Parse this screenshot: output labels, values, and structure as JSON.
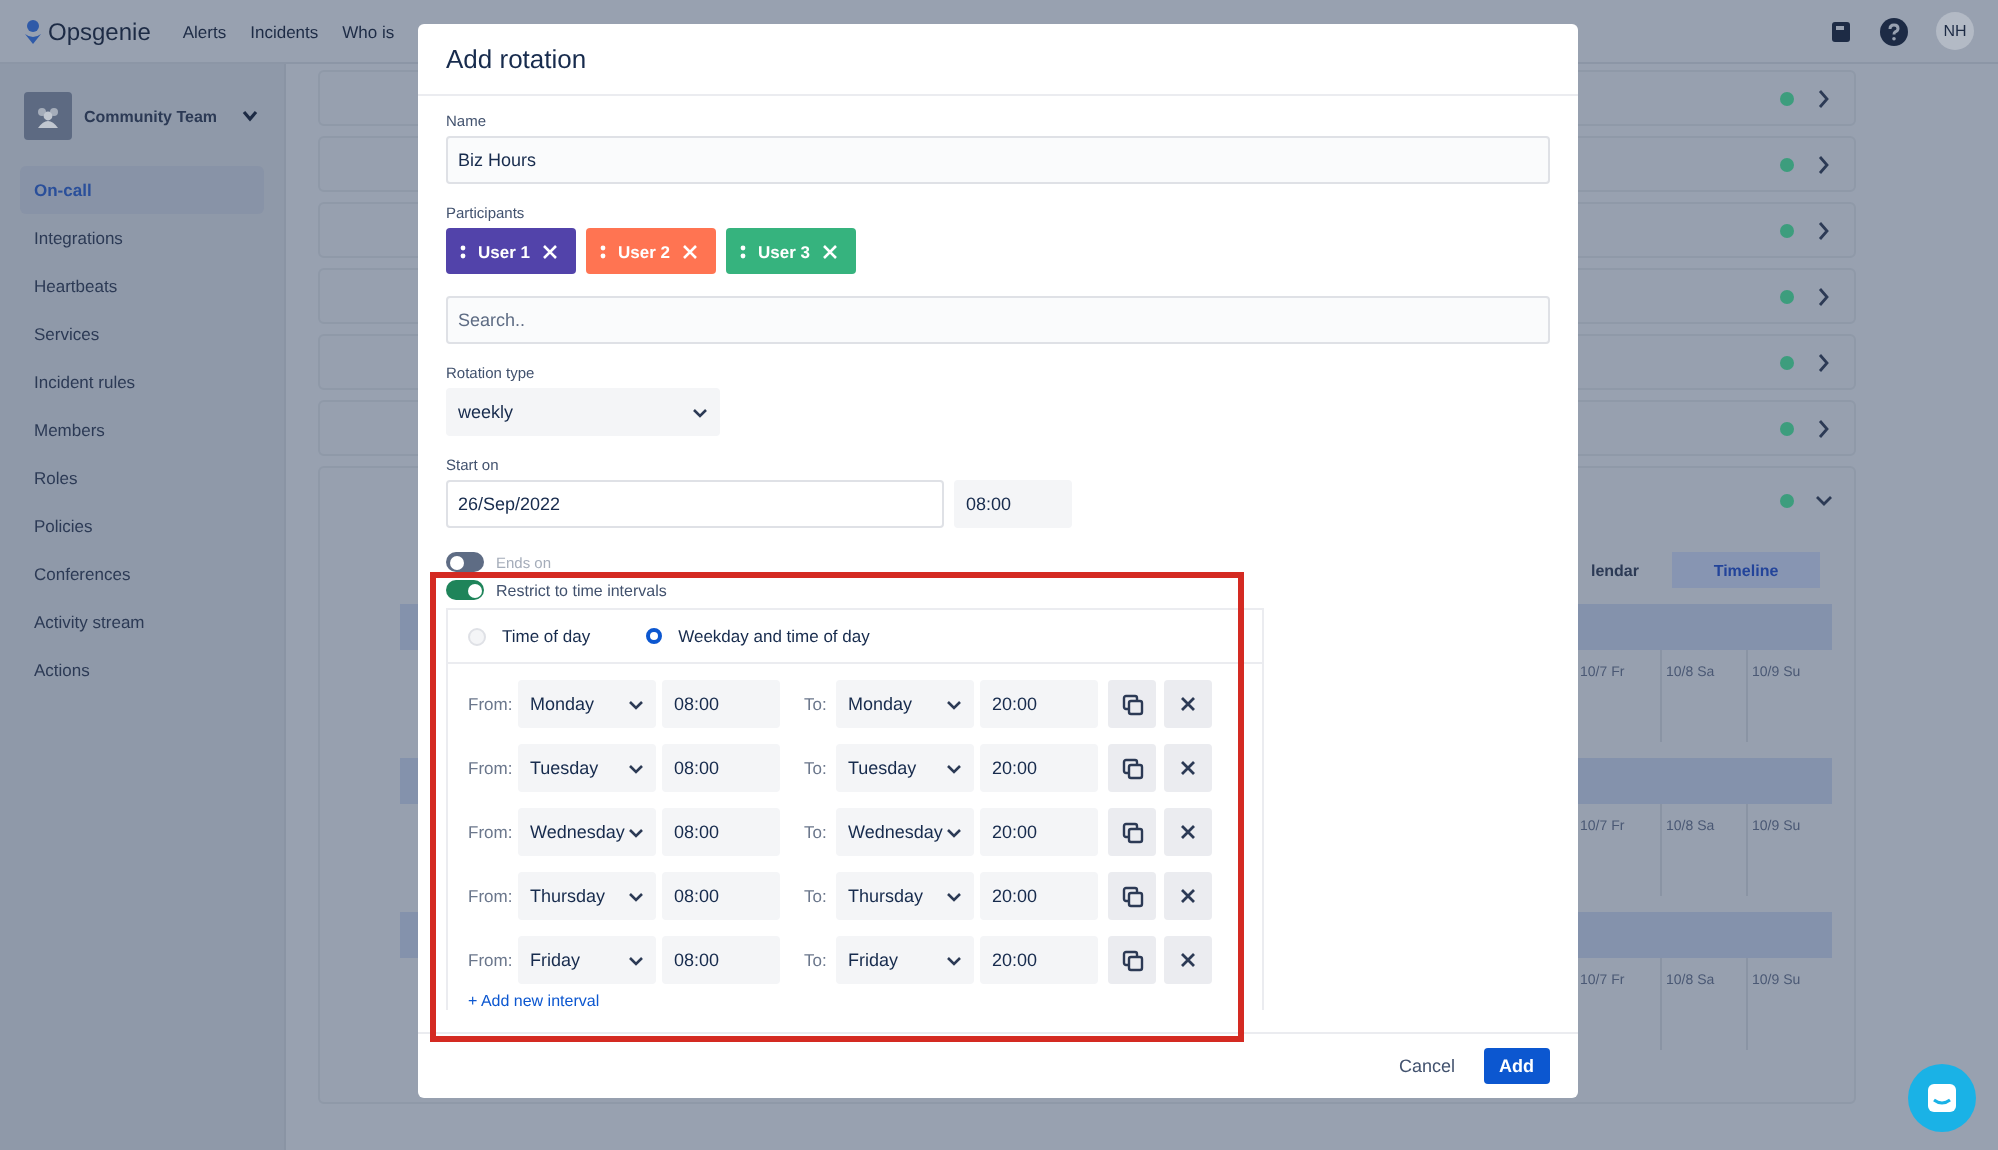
{
  "nav": {
    "logo": "Opsgenie",
    "links": [
      "Alerts",
      "Incidents",
      "Who is"
    ],
    "avatar": "NH"
  },
  "sidebar": {
    "team": "Community Team",
    "items": [
      {
        "label": "On-call",
        "selected": true
      },
      {
        "label": "Integrations",
        "selected": false
      },
      {
        "label": "Heartbeats",
        "selected": false
      },
      {
        "label": "Services",
        "selected": false
      },
      {
        "label": "Incident rules",
        "selected": false
      },
      {
        "label": "Members",
        "selected": false
      },
      {
        "label": "Roles",
        "selected": false
      },
      {
        "label": "Policies",
        "selected": false
      },
      {
        "label": "Conferences",
        "selected": false
      },
      {
        "label": "Activity stream",
        "selected": false
      },
      {
        "label": "Actions",
        "selected": false
      }
    ]
  },
  "schedules": [
    {
      "expanded": false
    },
    {
      "expanded": false
    },
    {
      "expanded": false
    },
    {
      "expanded": false
    },
    {
      "expanded": false
    },
    {
      "expanded": false
    },
    {
      "expanded": true
    }
  ],
  "view_tabs": [
    {
      "label": "lendar",
      "selected": false
    },
    {
      "label": "Timeline",
      "selected": true
    }
  ],
  "timeline": [
    {
      "days": [
        "10/7 Fr",
        "10/8 Sa",
        "10/9 Su"
      ]
    },
    {
      "days": [
        "10/7 Fr",
        "10/8 Sa",
        "10/9 Su"
      ]
    },
    {
      "days": [
        "10/7 Fr",
        "10/8 Sa",
        "10/9 Su"
      ]
    }
  ],
  "dialog": {
    "title": "Add rotation",
    "name": {
      "label": "Name",
      "value": "Biz Hours"
    },
    "participants": {
      "label": "Participants",
      "search_placeholder": "Search..",
      "users": [
        {
          "name": "User 1",
          "color": "#5243aa"
        },
        {
          "name": "User 2",
          "color": "#ff7452"
        },
        {
          "name": "User 3",
          "color": "#36b37e"
        }
      ]
    },
    "rotation_type": {
      "label": "Rotation type",
      "value": "weekly"
    },
    "start_on": {
      "label": "Start on",
      "date": "26/Sep/2022",
      "time": "08:00"
    },
    "ends_on": {
      "label": "Ends on",
      "on": false
    },
    "restrict": {
      "label": "Restrict to time intervals",
      "on": true,
      "modes": [
        {
          "label": "Time of day",
          "selected": false
        },
        {
          "label": "Weekday and time of day",
          "selected": true
        }
      ],
      "intervals": [
        {
          "from_label": "From:",
          "from_day": "Monday",
          "from_time": "08:00",
          "to_label": "To:",
          "to_day": "Monday",
          "to_time": "20:00"
        },
        {
          "from_label": "From:",
          "from_day": "Tuesday",
          "from_time": "08:00",
          "to_label": "To:",
          "to_day": "Tuesday",
          "to_time": "20:00"
        },
        {
          "from_label": "From:",
          "from_day": "Wednesday",
          "from_time": "08:00",
          "to_label": "To:",
          "to_day": "Wednesday",
          "to_time": "20:00"
        },
        {
          "from_label": "From:",
          "from_day": "Thursday",
          "from_time": "08:00",
          "to_label": "To:",
          "to_day": "Thursday",
          "to_time": "20:00"
        },
        {
          "from_label": "From:",
          "from_day": "Friday",
          "from_time": "08:00",
          "to_label": "To:",
          "to_day": "Friday",
          "to_time": "20:00"
        }
      ],
      "add_label": "+ Add new interval"
    },
    "buttons": {
      "cancel": "Cancel",
      "add": "Add"
    }
  }
}
